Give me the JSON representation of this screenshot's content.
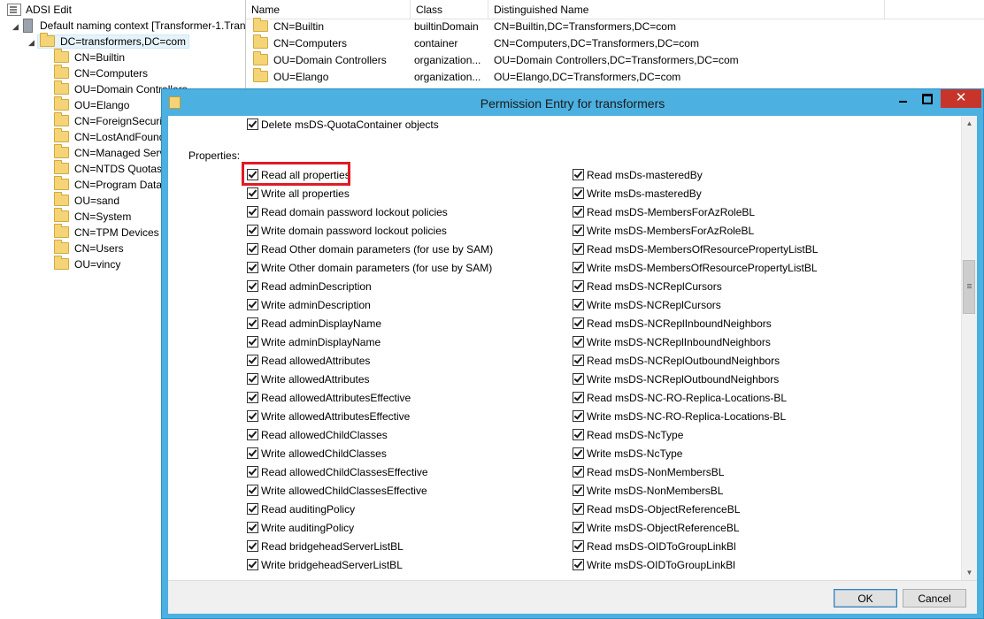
{
  "tree": {
    "root": "ADSI Edit",
    "context": "Default naming context [Transformer-1.Tran",
    "domain": "DC=transformers,DC=com",
    "children": [
      "CN=Builtin",
      "CN=Computers",
      "OU=Domain Controllers",
      "OU=Elango",
      "CN=ForeignSecuri",
      "CN=LostAndFound",
      "CN=Managed Serv",
      "CN=NTDS Quotas",
      "CN=Program Data",
      "OU=sand",
      "CN=System",
      "CN=TPM Devices",
      "CN=Users",
      "OU=vincy"
    ]
  },
  "list": {
    "columns": [
      "Name",
      "Class",
      "Distinguished Name"
    ],
    "rows": [
      {
        "name": "CN=Builtin",
        "class": "builtinDomain",
        "dn": "CN=Builtin,DC=Transformers,DC=com"
      },
      {
        "name": "CN=Computers",
        "class": "container",
        "dn": "CN=Computers,DC=Transformers,DC=com"
      },
      {
        "name": "OU=Domain Controllers",
        "class": "organization...",
        "dn": "OU=Domain Controllers,DC=Transformers,DC=com"
      },
      {
        "name": "OU=Elango",
        "class": "organization...",
        "dn": "OU=Elango,DC=Transformers,DC=com"
      }
    ]
  },
  "dialog": {
    "title": "Permission Entry for transformers",
    "top_item": "Delete msDS-QuotaContainer objects",
    "properties_label": "Properties:",
    "left_items": [
      "Read all properties",
      "Write all properties",
      "Read domain password  lockout policies",
      "Write domain password  lockout policies",
      "Read Other domain parameters (for use by SAM)",
      "Write Other domain parameters (for use by SAM)",
      "Read adminDescription",
      "Write adminDescription",
      "Read adminDisplayName",
      "Write adminDisplayName",
      "Read allowedAttributes",
      "Write allowedAttributes",
      "Read allowedAttributesEffective",
      "Write allowedAttributesEffective",
      "Read allowedChildClasses",
      "Write allowedChildClasses",
      "Read allowedChildClassesEffective",
      "Write allowedChildClassesEffective",
      "Read auditingPolicy",
      "Write auditingPolicy",
      "Read bridgeheadServerListBL",
      "Write bridgeheadServerListBL"
    ],
    "right_items": [
      "Read msDs-masteredBy",
      "Write msDs-masteredBy",
      "Read msDS-MembersForAzRoleBL",
      "Write msDS-MembersForAzRoleBL",
      "Read msDS-MembersOfResourcePropertyListBL",
      "Write msDS-MembersOfResourcePropertyListBL",
      "Read msDS-NCReplCursors",
      "Write msDS-NCReplCursors",
      "Read msDS-NCReplInboundNeighbors",
      "Write msDS-NCReplInboundNeighbors",
      "Read msDS-NCReplOutboundNeighbors",
      "Write msDS-NCReplOutboundNeighbors",
      "Read msDS-NC-RO-Replica-Locations-BL",
      "Write msDS-NC-RO-Replica-Locations-BL",
      "Read msDS-NcType",
      "Write msDS-NcType",
      "Read msDS-NonMembersBL",
      "Write msDS-NonMembersBL",
      "Read msDS-ObjectReferenceBL",
      "Write msDS-ObjectReferenceBL",
      "Read msDS-OIDToGroupLinkBl",
      "Write msDS-OIDToGroupLinkBl"
    ],
    "ok_label": "OK",
    "cancel_label": "Cancel",
    "close_glyph": "✕"
  },
  "colors": {
    "titlebar": "#4cb0e0",
    "close": "#c7352a",
    "highlight": "#e01b24"
  }
}
